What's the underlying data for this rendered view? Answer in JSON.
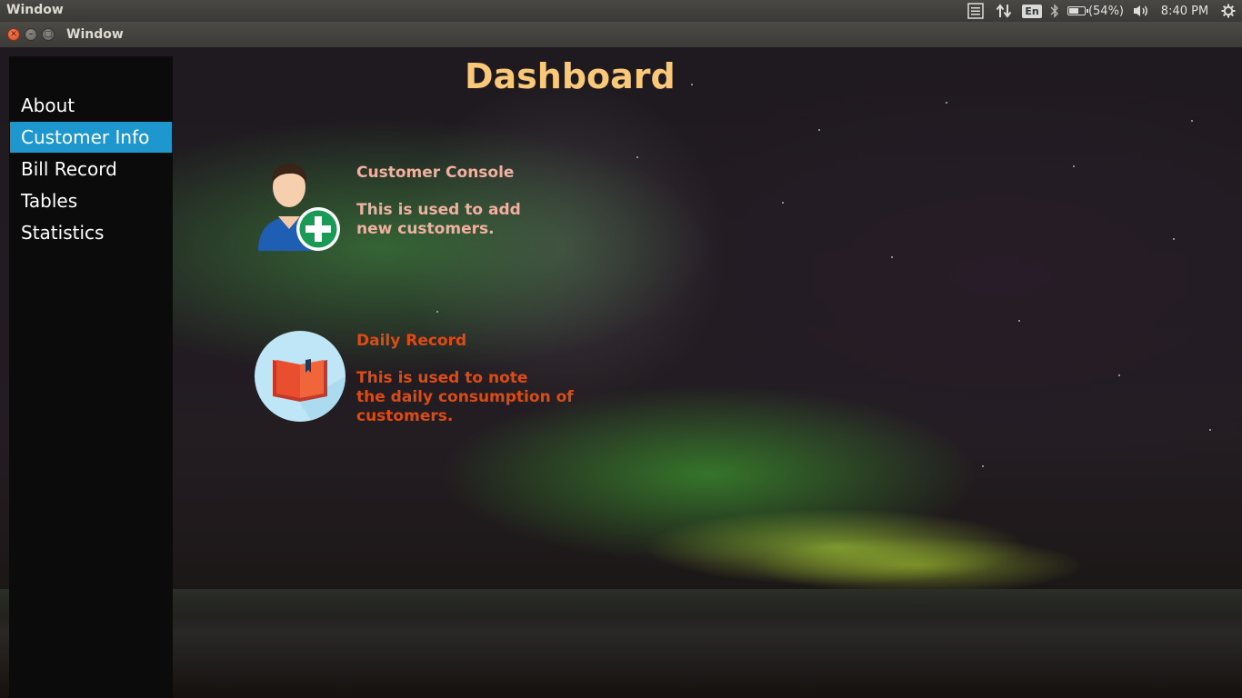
{
  "top_panel": {
    "app_title": "Window",
    "keyboard_layout": "En",
    "battery_percent": "(54%)",
    "battery_level": 0.54,
    "clock": "8:40 PM",
    "icons": [
      "menu-list-icon",
      "network-arrows-icon",
      "keyboard-icon",
      "bluetooth-icon",
      "battery-icon",
      "volume-icon",
      "settings-gear-icon"
    ]
  },
  "window": {
    "title": "Window",
    "controls": [
      "close",
      "minimize",
      "maximize"
    ]
  },
  "sidebar": {
    "items": [
      {
        "label": "About",
        "active": false
      },
      {
        "label": "Customer Info",
        "active": true
      },
      {
        "label": "Bill Record",
        "active": false
      },
      {
        "label": "Tables",
        "active": false
      },
      {
        "label": "Statistics",
        "active": false
      }
    ]
  },
  "main": {
    "title": "Dashboard",
    "cards": [
      {
        "icon": "add-customer-icon",
        "title": "Customer Console",
        "description": "This is used to add\nnew customers.",
        "color": "#f0b0a0"
      },
      {
        "icon": "book-icon",
        "title": "Daily Record",
        "description": "This is used to note\nthe daily consumption of\ncustomers.",
        "color": "#dd4b14"
      }
    ]
  },
  "colors": {
    "accent": "#1e97cf",
    "title": "#f9c878",
    "sidebar_bg": "#0b0b0b"
  }
}
